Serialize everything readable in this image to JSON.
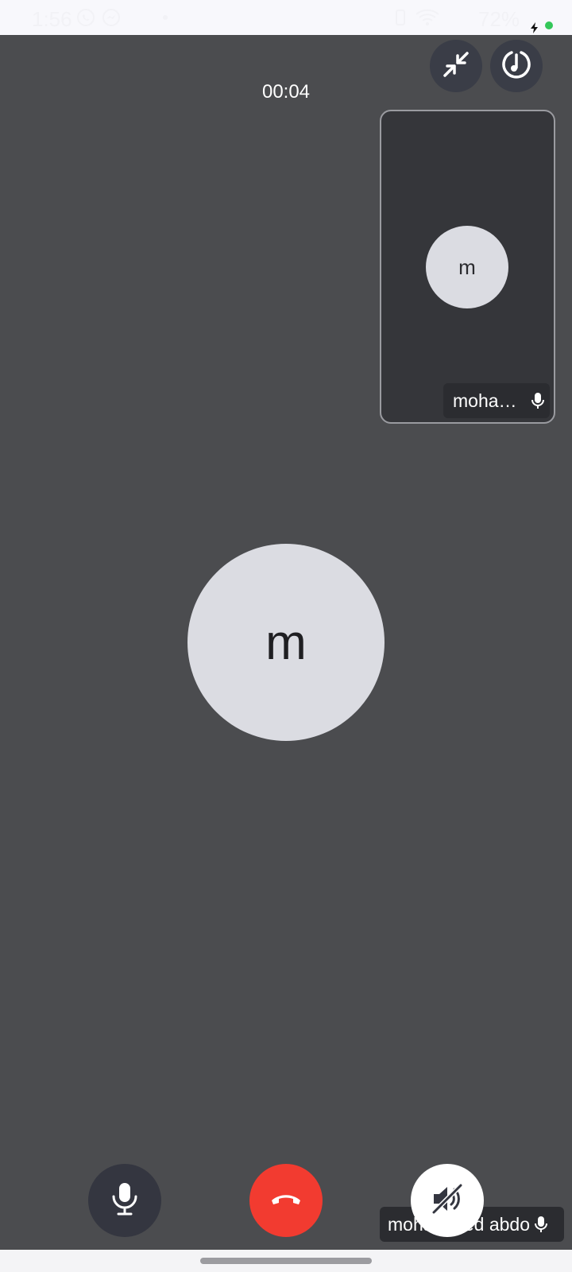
{
  "status_bar": {
    "time": "1:56",
    "battery": "72%",
    "icons": [
      "whatsapp-icon",
      "messenger-icon",
      "dot-icon",
      "vibrate-icon",
      "wifi-icon",
      "charging-icon"
    ],
    "dot_color": "#34c759"
  },
  "call": {
    "timer": "00:04",
    "background_color": "#4b4c4f"
  },
  "top_controls": {
    "minimize_icon": "minimize-arrows-icon",
    "effects_icon": "audio-effects-icon"
  },
  "pip": {
    "avatar_initial": "m",
    "name": "moha…",
    "mic_icon": "microphone-icon"
  },
  "main": {
    "avatar_initial": "m"
  },
  "bottom_controls": {
    "mic_icon": "microphone-icon",
    "end_call_icon": "end-call-icon",
    "speaker_icon": "speaker-muted-icon",
    "end_call_color": "#f23b30"
  },
  "self_view": {
    "name": "mohammed abdo"
  }
}
